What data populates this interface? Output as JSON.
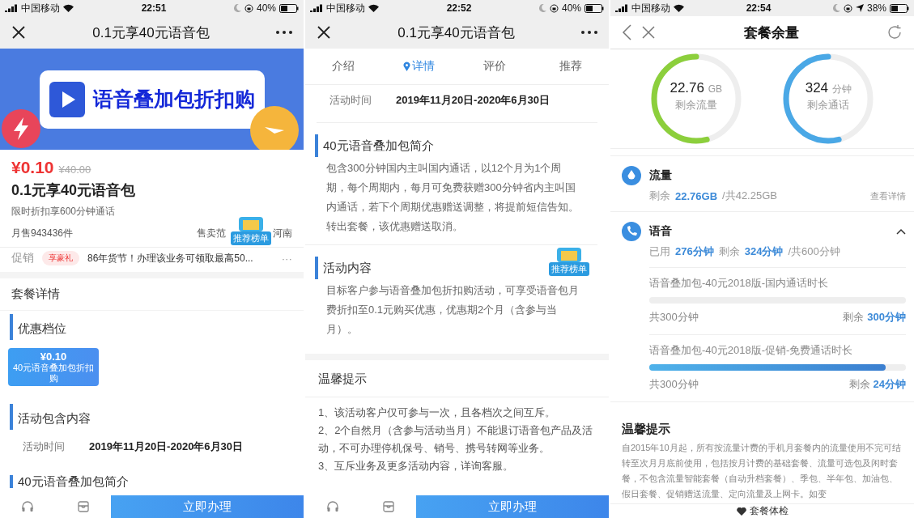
{
  "screens": [
    {
      "status_bar": {
        "carrier": "中国移动",
        "time": "22:51",
        "battery": "40%",
        "location": false
      },
      "nav": {
        "title": "0.1元享40元语音包"
      },
      "banner": {
        "title": "语音叠加包折扣购"
      },
      "price": {
        "current": "¥0.10",
        "original": "¥40.00"
      },
      "product_title": "0.1元享40元语音包",
      "subtitle": "限时折扣享600分钟通话",
      "sales": "月售943436件",
      "range_left": "售卖范",
      "range_right": "河南",
      "floating_badge": "推荐榜单",
      "promo": {
        "label": "促销",
        "tag": "享豪礼",
        "text": "86年货节！办理该业务可领取最高50...",
        "more": "···"
      },
      "section_header": "套餐详情",
      "tier_heading": "优惠档位",
      "tiers": [
        {
          "price": "¥0.10",
          "name": "40元语音叠加包折扣购",
          "selected": true
        }
      ],
      "content_heading": "活动包含内容",
      "period": {
        "label": "活动时间",
        "value": "2019年11月20日-2020年6月30日"
      },
      "next_heading": "40元语音叠加包简介",
      "action": "立即办理"
    },
    {
      "status_bar": {
        "carrier": "中国移动",
        "time": "22:52",
        "battery": "40%",
        "location": false
      },
      "nav": {
        "title": "0.1元享40元语音包"
      },
      "tabs": [
        {
          "label": "介绍",
          "selected": false
        },
        {
          "label": "详情",
          "selected": true
        },
        {
          "label": "评价",
          "selected": false
        },
        {
          "label": "推荐",
          "selected": false
        }
      ],
      "period": {
        "label": "活动时间",
        "value": "2019年11月20日-2020年6月30日"
      },
      "sections": [
        {
          "heading": "40元语音叠加包简介",
          "text": "包含300分钟国内主叫国内通话，以12个月为1个周期，每个周期内，每月可免费获赠300分钟省内主叫国内通话，若下个周期优惠赠送调整，将提前短信告知。转出套餐，该优惠赠送取消。"
        },
        {
          "heading": "活动内容",
          "text": "目标客户参与语音叠加包折扣购活动，可享受语音包月费折扣至0.1元购买优惠，优惠期2个月（含参与当月）。"
        }
      ],
      "floating_badge": "推荐榜单",
      "tips_header": "温馨提示",
      "tips": [
        "1、该活动客户仅可参与一次，且各档次之间互斥。",
        "2、2个自然月（含参与活动当月）不能退订语音包产品及活动，不可办理停机保号、销号、携号转网等业务。",
        "3、互斥业务及更多活动内容，详询客服。"
      ],
      "action": "立即办理"
    },
    {
      "status_bar": {
        "carrier": "中国移动",
        "time": "22:54",
        "battery": "38%",
        "location": true
      },
      "nav": {
        "title": "套餐余量"
      },
      "gauges": [
        {
          "value": "22.76",
          "unit": "GB",
          "label": "剩余流量",
          "level": 0.54,
          "color": "#8ccf3c"
        },
        {
          "value": "324",
          "unit": "分钟",
          "label": "剩余通话",
          "level": 0.54,
          "color": "#4aa8e6"
        }
      ],
      "usage": [
        {
          "kind": "data",
          "title": "流量",
          "parts": [
            {
              "text": "剩余",
              "hl": false
            },
            {
              "text": "22.76GB",
              "hl": true
            },
            {
              "text": "/共42.25GB",
              "hl": false
            }
          ],
          "link": "查看详情"
        },
        {
          "kind": "voice",
          "title": "语音",
          "expanded": true,
          "parts": [
            {
              "text": "已用",
              "hl": false
            },
            {
              "text": "276分钟",
              "hl": true
            },
            {
              "text": "剩余",
              "hl": false
            },
            {
              "text": "324分钟",
              "hl": true
            },
            {
              "text": "/共600分钟",
              "hl": false
            }
          ],
          "items": [
            {
              "name": "语音叠加包-40元2018版-国内通话时长",
              "level": 0,
              "total": "共300分钟",
              "left_label": "剩余",
              "left_value": "300分钟"
            },
            {
              "name": "语音叠加包-40元2018版-促销-免费通话时长",
              "level": 0.92,
              "total": "共300分钟",
              "left_label": "剩余",
              "left_value": "24分钟"
            }
          ]
        }
      ],
      "tips_header": "温馨提示",
      "tips_text": "自2015年10月起，所有按流量计费的手机月套餐内的流量使用不完可结转至次月月底前使用，包括按月计费的基础套餐、流量可选包及闲时套餐，不包含流量智能套餐（自动升档套餐）、季包、半年包、加油包、假日套餐、促销赠送流量、定向流量及上网卡。如变",
      "bottom_tab": "套餐体检"
    }
  ]
}
